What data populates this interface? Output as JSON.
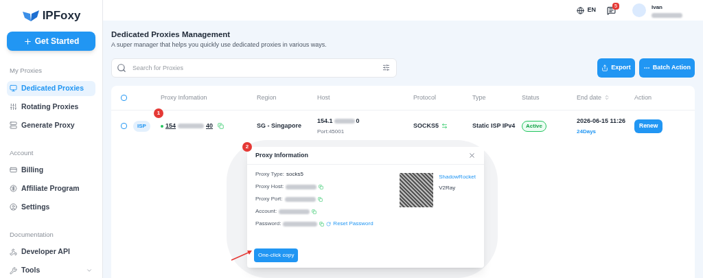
{
  "logo": {
    "text": "IPFoxy"
  },
  "get_started": {
    "label": "Get Started"
  },
  "sidebar": {
    "sections": [
      {
        "title": "My Proxies",
        "items": [
          {
            "label": "Dedicated Proxies",
            "selected": true
          },
          {
            "label": "Rotating Proxies",
            "selected": false
          },
          {
            "label": "Generate Proxy",
            "selected": false
          }
        ]
      },
      {
        "title": "Account",
        "items": [
          {
            "label": "Billing",
            "selected": false
          },
          {
            "label": "Affiliate Program",
            "selected": false
          },
          {
            "label": "Settings",
            "selected": false
          }
        ]
      },
      {
        "title": "Documentation",
        "items": [
          {
            "label": "Developer API",
            "selected": false
          },
          {
            "label": "Tools",
            "selected": false,
            "expandable": true
          }
        ]
      }
    ]
  },
  "topbar": {
    "language": "EN",
    "notifications": "5",
    "user": "Ivan"
  },
  "page": {
    "title": "Dedicated Proxies Management",
    "subtitle": "A super manager that helps you quickly use dedicated proxies in various ways."
  },
  "search": {
    "placeholder": "Search for Proxies"
  },
  "buttons": {
    "export": "Export",
    "batch": "Batch Action"
  },
  "table": {
    "all_checked": false,
    "columns": [
      "Proxy Infomation",
      "Region",
      "Host",
      "Protocol",
      "Type",
      "Status",
      "End date",
      "Action"
    ],
    "rows": [
      {
        "checked": false,
        "tag": "ISP",
        "ip_start": "154",
        "ip_end": "40",
        "online": true,
        "region": "SG - Singapore",
        "host": "154.1",
        "host_end": "0",
        "port": "Port:45001",
        "protocol": "SOCKS5",
        "type": "Static ISP IPv4",
        "status": "Active",
        "end_date": "2026-06-15 11:26",
        "days": "24Days",
        "action": "Renew"
      }
    ]
  },
  "modal": {
    "title": "Proxy Information",
    "fields": [
      {
        "label": "Proxy Type:",
        "value": "socks5",
        "kind": "plain"
      },
      {
        "label": "Proxy Host:",
        "kind": "hidden"
      },
      {
        "label": "Proxy Port:",
        "kind": "hidden"
      },
      {
        "label": "Account:",
        "kind": "hidden"
      },
      {
        "label": "Password:",
        "kind": "hidden",
        "reset": "Reset Password"
      }
    ],
    "apps": [
      "ShadowRocket",
      "V2Ray"
    ],
    "copy": "One-click copy"
  },
  "annotations": [
    "1",
    "2"
  ]
}
